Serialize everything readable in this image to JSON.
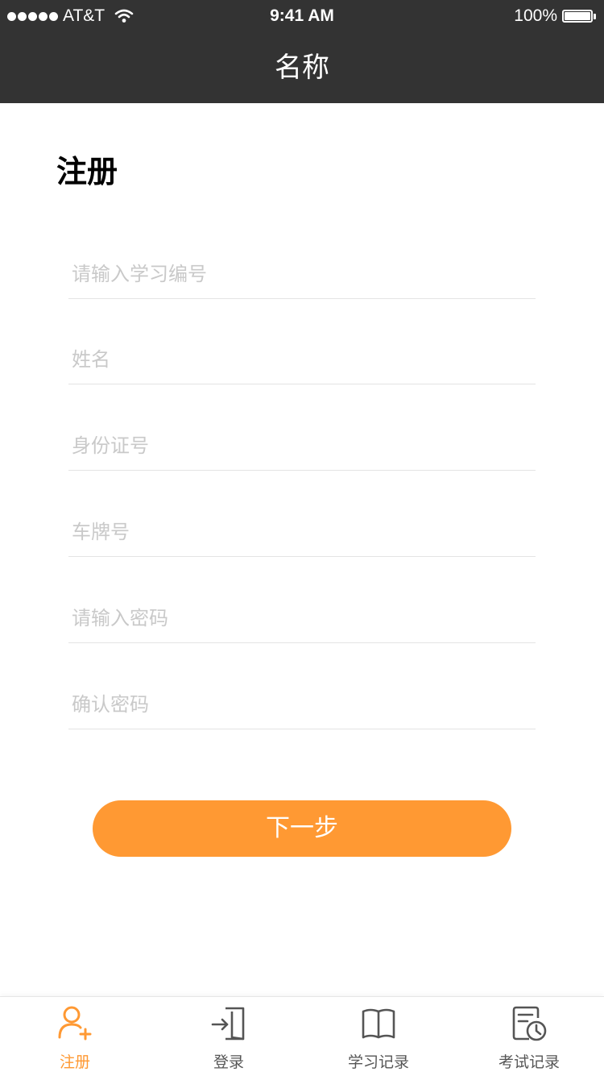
{
  "status_bar": {
    "carrier": "AT&T",
    "time": "9:41 AM",
    "battery": "100%",
    "signal_icon": "signal-dots-icon",
    "wifi_icon": "wifi-icon",
    "battery_icon": "battery-icon",
    "battery_level": 1.0
  },
  "nav": {
    "title": "名称"
  },
  "form": {
    "title": "注册",
    "fields": [
      {
        "placeholder": "请输入学习编号",
        "value": ""
      },
      {
        "placeholder": "姓名",
        "value": ""
      },
      {
        "placeholder": "身份证号",
        "value": ""
      },
      {
        "placeholder": "车牌号",
        "value": ""
      },
      {
        "placeholder": "请输入密码",
        "value": ""
      },
      {
        "placeholder": "确认密码",
        "value": ""
      }
    ],
    "next_label": "下一步"
  },
  "tabbar": {
    "items": [
      {
        "label": "注册",
        "icon": "add-user-icon",
        "active": true
      },
      {
        "label": "登录",
        "icon": "login-door-icon",
        "active": false
      },
      {
        "label": "学习记录",
        "icon": "open-book-icon",
        "active": false
      },
      {
        "label": "考试记录",
        "icon": "exam-record-clock-icon",
        "active": false
      }
    ]
  },
  "colors": {
    "header_bg": "#333333",
    "accent": "#ff9933",
    "placeholder": "#c9c9c9",
    "divider": "#e4e4e4",
    "tab_inactive": "#555555"
  }
}
